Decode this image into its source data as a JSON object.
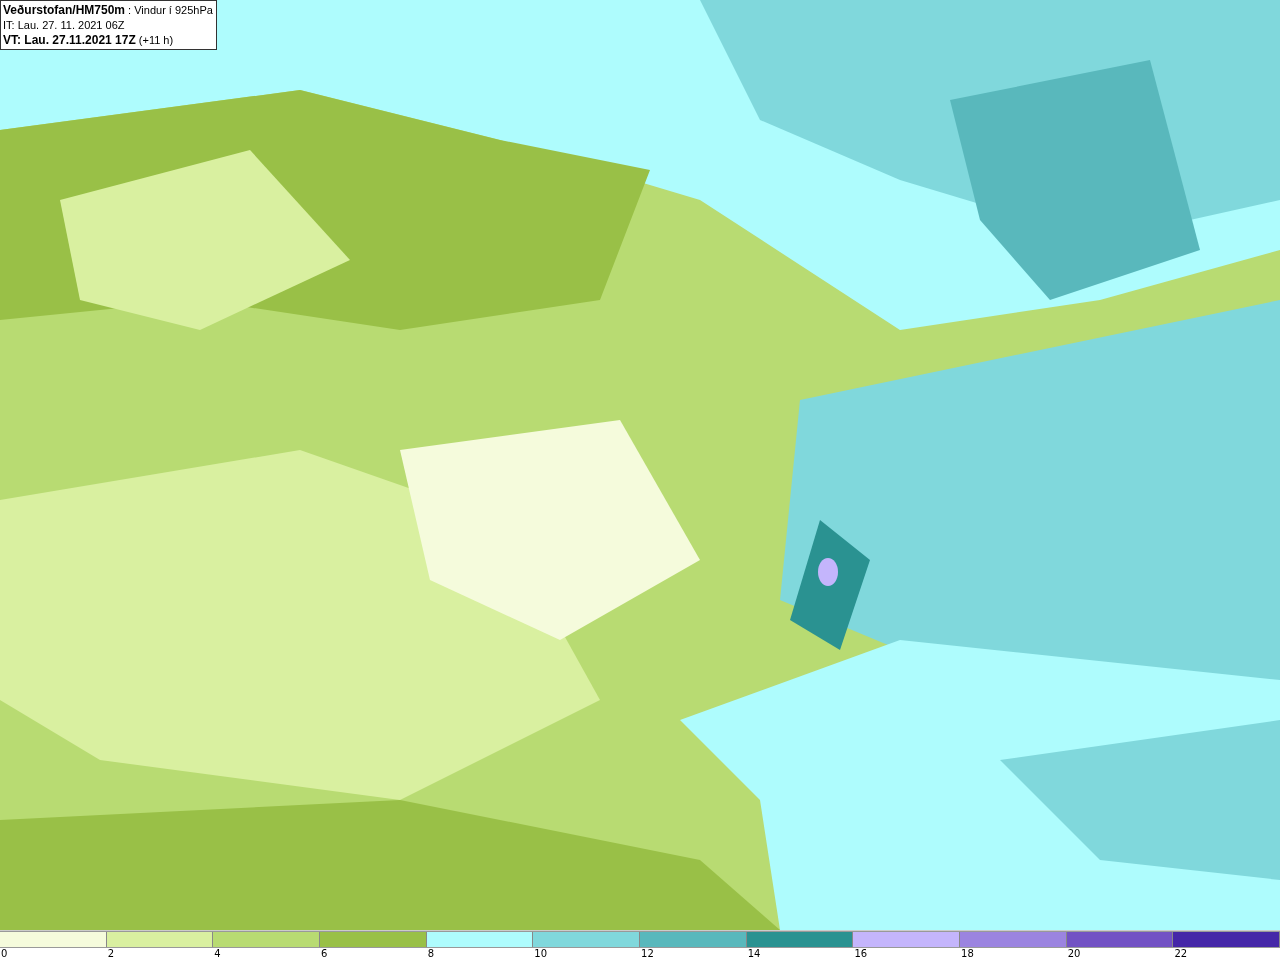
{
  "header": {
    "lines": [
      "**Veðurstofan/HM750m** : Vindur í 925hPa",
      "IT: Lau. 27. 11. 2021 06Z",
      "**VT: Lau. 27.11.2021 17Z** (+11 h)"
    ]
  },
  "legend": {
    "bins": [
      {
        "label": "0",
        "color": "#f5fbdc"
      },
      {
        "label": "2",
        "color": "#d9f0a0"
      },
      {
        "label": "4",
        "color": "#b8db72"
      },
      {
        "label": "6",
        "color": "#99c047"
      },
      {
        "label": "8",
        "color": "#aefcfd"
      },
      {
        "label": "10",
        "color": "#80d8dc"
      },
      {
        "label": "12",
        "color": "#59b8bc"
      },
      {
        "label": "14",
        "color": "#2a9291"
      },
      {
        "label": "16",
        "color": "#c4b5fc"
      },
      {
        "label": "18",
        "color": "#9b84e0"
      },
      {
        "label": "20",
        "color": "#7252c4"
      },
      {
        "label": "22",
        "color": "#4527a8"
      }
    ]
  }
}
